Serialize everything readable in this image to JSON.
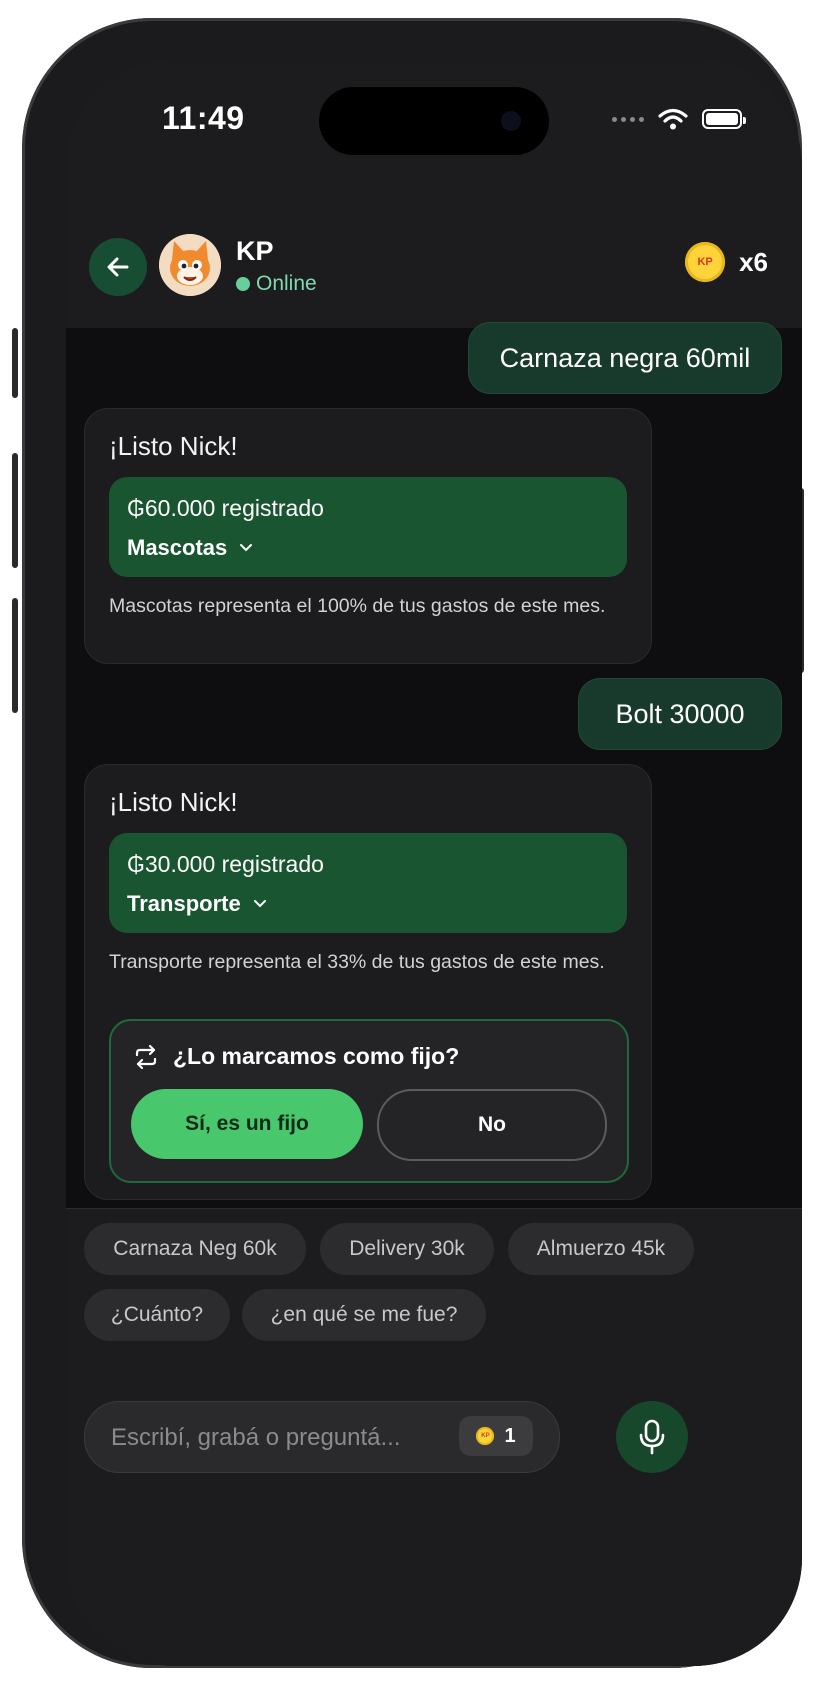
{
  "status_bar": {
    "time": "11:49"
  },
  "header": {
    "contact_name": "KP",
    "status": "Online",
    "coin_icon_text": "KP",
    "coin_multiplier": "x6"
  },
  "messages": {
    "user1": "Carnaza negra 60mil",
    "bot1": {
      "title": "¡Listo Nick!",
      "amount": "₲60.000 registrado",
      "category": "Mascotas",
      "description": "Mascotas representa el 100% de tus gastos de este mes."
    },
    "user2": "Bolt 30000",
    "bot2": {
      "title": "¡Listo Nick!",
      "amount": "₲30.000 registrado",
      "category": "Transporte",
      "description": "Transporte representa el 33% de tus gastos de este mes.",
      "fixed_question": "¿Lo marcamos como fijo?",
      "yes_label": "Sí, es un fijo",
      "no_label": "No"
    }
  },
  "suggestions": [
    "Carnaza Neg 60k",
    "Delivery 30k",
    "Almuerzo 45k",
    "¿Cuánto?",
    "¿en qué se me fue?"
  ],
  "input": {
    "placeholder": "Escribí, grabá o preguntá...",
    "badge_coin_text": "KP",
    "badge_count": "1"
  },
  "colors": {
    "accent_green": "#48c76d",
    "card_green": "#185530",
    "background": "#0e0e10"
  }
}
